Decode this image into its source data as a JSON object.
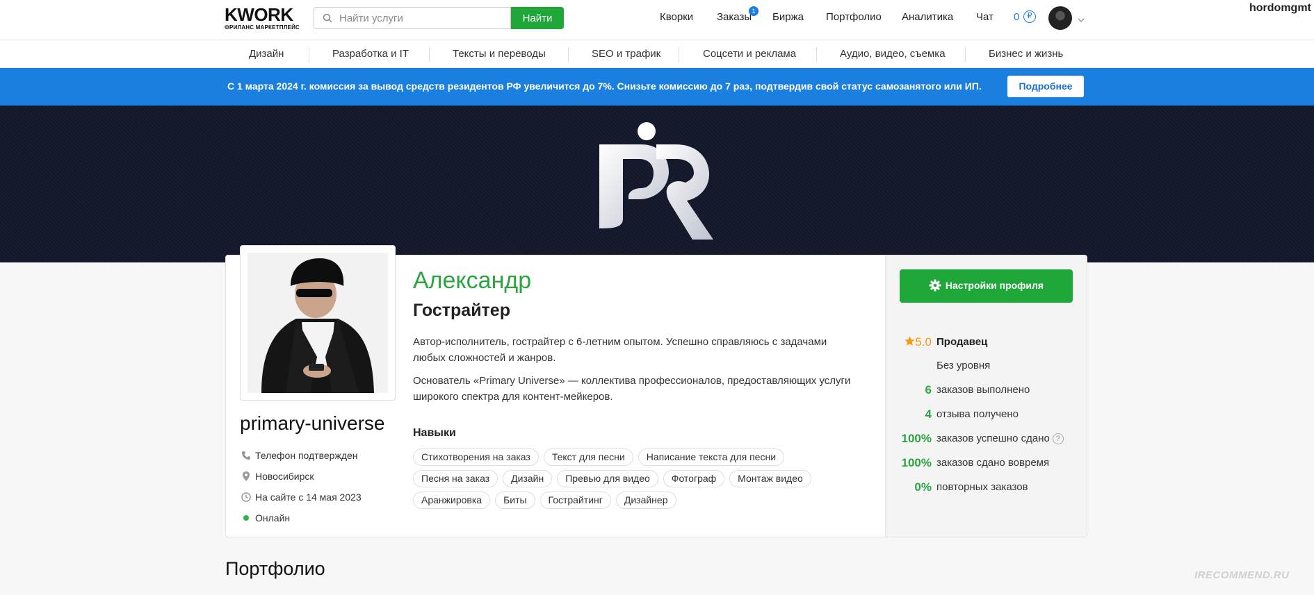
{
  "header": {
    "logo_word": "KWORK",
    "logo_sub": "ФРИЛАНС МАРКЕТПЛЕЙС",
    "search_placeholder": "Найти услуги",
    "search_button": "Найти",
    "nav": [
      "Кворки",
      "Заказы",
      "Биржа",
      "Портфолио",
      "Аналитика",
      "Чат"
    ],
    "orders_badge": "1",
    "balance": "0",
    "currency_symbol": "₽",
    "account_name": "hordomgmt"
  },
  "categories": [
    "Дизайн",
    "Разработка и IT",
    "Тексты и переводы",
    "SEO и трафик",
    "Соцсети и реклама",
    "Аудио, видео, съемка",
    "Бизнес и жизнь"
  ],
  "banner": {
    "message": "С 1 марта 2024 г. комиссия за вывод средств резидентов РФ увеличится до 7%. Снизьте комиссию до 7 раз, подтвердив свой статус самозанятого или ИП.",
    "button": "Подробнее"
  },
  "profile": {
    "username": "primary-universe",
    "name": "Александр",
    "title": "Гострайтер",
    "about": [
      "Автор-исполнитель, гострайтер с 6-летним опытом. Успешно справляюсь с задачами любых сложностей и жанров.",
      "Основатель «Primary Universe» — коллектива профессионалов, предоставляющих услуги широкого спектра для контент-мейкеров."
    ],
    "meta": {
      "phone": "Телефон подтвержден",
      "city": "Новосибирск",
      "since": "На сайте с 14 мая 2023",
      "status": "Онлайн"
    },
    "skills_heading": "Навыки",
    "skills": [
      "Стихотворения на заказ",
      "Текст для песни",
      "Написание текста для песни",
      "Песня на заказ",
      "Дизайн",
      "Превью для видео",
      "Фотограф",
      "Монтаж видео",
      "Аранжировка",
      "Биты",
      "Гострайтинг",
      "Дизайнер"
    ]
  },
  "sidebar": {
    "settings_button": "Настройки профиля",
    "rating": "5.0",
    "role": "Продавец",
    "level": "Без уровня",
    "stats": [
      {
        "value": "6",
        "label": "заказов выполнено"
      },
      {
        "value": "4",
        "label": "отзыва получено"
      },
      {
        "value": "100%",
        "label": "заказов успешно сдано"
      },
      {
        "value": "100%",
        "label": "заказов сдано вовремя"
      },
      {
        "value": "0%",
        "label": "повторных заказов"
      }
    ],
    "help_glyph": "?"
  },
  "portfolio_heading": "Портфолио",
  "watermark": "IRECOMMEND.RU",
  "colors": {
    "accent_green": "#1fa73a",
    "name_green": "#2ba53f",
    "banner_blue": "#1b7fe0",
    "rating_orange": "#f39c12"
  }
}
